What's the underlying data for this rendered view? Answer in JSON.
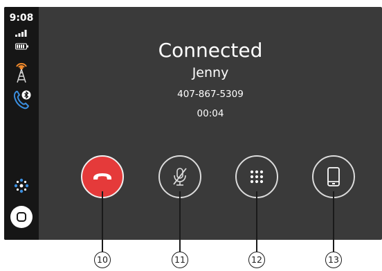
{
  "sidebar": {
    "time": "9:08",
    "signal_icon": "cellular-signal-icon",
    "battery_icon": "battery-icon",
    "radio_icon": "radio-tower-icon",
    "phone_icon": "bluetooth-phone-icon",
    "apps_icon": "app-grid-icon",
    "home_icon": "home-button-icon"
  },
  "call": {
    "status": "Connected",
    "contact_name": "Jenny",
    "phone_number": "407-867-5309",
    "duration": "00:04"
  },
  "controls": [
    {
      "name": "end-call",
      "icon": "end-call-icon",
      "color": "#e53a3a",
      "callout": "10"
    },
    {
      "name": "mute",
      "icon": "microphone-muted-icon",
      "callout": "11"
    },
    {
      "name": "keypad",
      "icon": "keypad-icon",
      "callout": "12"
    },
    {
      "name": "handset",
      "icon": "phone-handset-icon",
      "callout": "13"
    }
  ],
  "callouts": {
    "c10": "10",
    "c11": "11",
    "c12": "12",
    "c13": "13"
  }
}
